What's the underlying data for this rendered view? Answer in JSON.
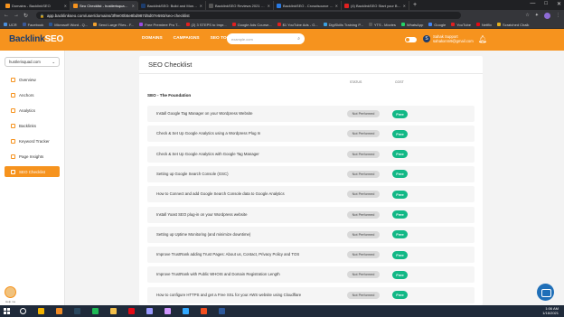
{
  "browser": {
    "tabs": [
      {
        "title": "Domains - BacklinkSEO",
        "color": "#f6931e",
        "active": false
      },
      {
        "title": "Seo Checklist - hustlerisquad.com",
        "color": "#f6931e",
        "active": true
      },
      {
        "title": "BacklinkSEO: Build and Monitor",
        "color": "#1d3d6d",
        "active": false
      },
      {
        "title": "BacklinkSEO Reviews 2021 - Cap",
        "color": "#555555",
        "active": false
      },
      {
        "title": "BacklinkSEO - Crowdsource Conc",
        "color": "#2a7ae2",
        "active": false
      },
      {
        "title": "(4) BacklinkSEO Start your Backl",
        "color": "#e02020",
        "active": false
      }
    ],
    "url": "app.backlinkseo.com/user/domains/3f9e00b5e8bd987d5d07e593/seo-checklist",
    "bookmarks": [
      {
        "label": "UCR",
        "color": "#4a8fdc"
      },
      {
        "label": "Facebook",
        "color": "#3b5998"
      },
      {
        "label": "Microsoft Word - Q...",
        "color": "#2b5797"
      },
      {
        "label": "Send Large Files - F...",
        "color": "#f0a030"
      },
      {
        "label": "Free Premiere Pro T...",
        "color": "#9a4ae0"
      },
      {
        "label": "(2) 3 STEPS to Impr...",
        "color": "#e02020"
      },
      {
        "label": "Google Ads Course...",
        "color": "#e02020"
      },
      {
        "label": "$1 YouTube Ads - G...",
        "color": "#e02020"
      },
      {
        "label": "DigiSkills Training P...",
        "color": "#3aa0e0"
      },
      {
        "label": "YTS - Movies",
        "color": "#5a5a5a"
      },
      {
        "label": "WhatsApp",
        "color": "#25d366"
      },
      {
        "label": "Google",
        "color": "#4285f4"
      },
      {
        "label": "YouTube",
        "color": "#e02020"
      },
      {
        "label": "Netflix",
        "color": "#e50914"
      },
      {
        "label": "Scratched Chalk",
        "color": "#e0b020"
      }
    ]
  },
  "app": {
    "logo_part1": "Backlink",
    "logo_part2": "SEO",
    "nav": [
      "DOMAINS",
      "CAMPAIGNS",
      "SEO TOOLS"
    ],
    "search_placeholder": "example.com",
    "user_name": "Sahak Support",
    "user_email": "sahakxnm9@gmail.com",
    "user_initial": "S"
  },
  "sidebar": {
    "domain": "hustlerisquad.com",
    "items": [
      {
        "label": "Overview",
        "active": false
      },
      {
        "label": "Anchors",
        "active": false
      },
      {
        "label": "Analytics",
        "active": false
      },
      {
        "label": "Backlinks",
        "active": false
      },
      {
        "label": "Keyword Tracker",
        "active": false
      },
      {
        "label": "Page Insights",
        "active": false
      },
      {
        "label": "SEO Checklist",
        "active": true
      }
    ],
    "help_label": "Help me"
  },
  "checklist": {
    "title": "SEO Checklist",
    "status_header": "STATUS",
    "cost_header": "COST",
    "section_title": "SEO - The Foundation",
    "rows": [
      {
        "task": "Install Google Tag Manager on your Wordpress Website",
        "status": "Not Performed",
        "cost": "Free"
      },
      {
        "task": "Check & Set Up Google Analytics using a Wordpress Plug In",
        "status": "Not Performed",
        "cost": "Free"
      },
      {
        "task": "Check & Set Up Google Analytics with Google Tag Manager",
        "status": "Not Performed",
        "cost": "Free"
      },
      {
        "task": "Setting up Google Search Console (GSC)",
        "status": "Not Performed",
        "cost": "Free"
      },
      {
        "task": "How to Connect and add Google Search Console data to Google Analytics",
        "status": "Not Performed",
        "cost": "Free"
      },
      {
        "task": "Install Yoast SEO plug-in on your Wordpress website",
        "status": "Not Performed",
        "cost": "Free"
      },
      {
        "task": "Setting up Uptime Monitoring (and minimize downtime)",
        "status": "Not Performed",
        "cost": "Free"
      },
      {
        "task": "Improve TrustRank adding Trust Pages: About us, Contact, Privacy Policy and TOS",
        "status": "Not Performed",
        "cost": "Free"
      },
      {
        "task": "Improve TrustRank with Public WHOIS and Domain Registration Length",
        "status": "Not Performed",
        "cost": "Free"
      },
      {
        "task": "How to configure HTTPS and get a Free SSL for your AWS website using Cloudflare",
        "status": "Not Performed",
        "cost": "Free"
      }
    ]
  },
  "taskbar": {
    "time": "1:06 AM",
    "date": "1/16/2021",
    "icons": [
      {
        "name": "search-icon",
        "color": "#ffffff"
      },
      {
        "name": "chrome-icon",
        "color": "#f4b400"
      },
      {
        "name": "vlc-icon",
        "color": "#f08a24"
      },
      {
        "name": "steam-icon",
        "color": "#2a475e"
      },
      {
        "name": "spotify-icon",
        "color": "#1db954"
      },
      {
        "name": "explorer-icon",
        "color": "#f3c04b"
      },
      {
        "name": "netflix-icon",
        "color": "#e50914"
      },
      {
        "name": "premiere-icon",
        "color": "#9999ff"
      },
      {
        "name": "aftereffects-icon",
        "color": "#cf96fd"
      },
      {
        "name": "photoshop-icon",
        "color": "#31a8ff"
      },
      {
        "name": "figma-icon",
        "color": "#f24e1e"
      },
      {
        "name": "word-icon",
        "color": "#2b579a"
      }
    ]
  }
}
